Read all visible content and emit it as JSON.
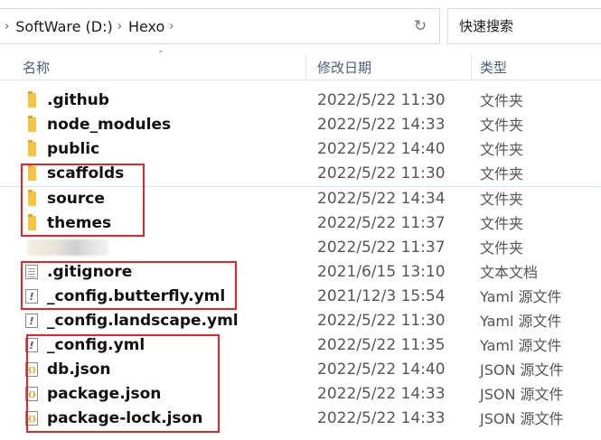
{
  "address": {
    "crumbs": [
      "SoftWare (D:)",
      "Hexo"
    ]
  },
  "search": {
    "placeholder": "快速搜索"
  },
  "columns": {
    "name": "名称",
    "date": "修改日期",
    "type": "类型"
  },
  "files": [
    {
      "name": ".github",
      "date": "2022/5/22 11:30",
      "type": "文件夹",
      "icon": "folder-icon"
    },
    {
      "name": "node_modules",
      "date": "2022/5/22 14:33",
      "type": "文件夹",
      "icon": "folder-icon"
    },
    {
      "name": "public",
      "date": "2022/5/22 14:40",
      "type": "文件夹",
      "icon": "folder-icon"
    },
    {
      "name": "scaffolds",
      "date": "2022/5/22 11:30",
      "type": "文件夹",
      "icon": "folder-icon"
    },
    {
      "name": "source",
      "date": "2022/5/22 14:34",
      "type": "文件夹",
      "icon": "folder-icon"
    },
    {
      "name": "themes",
      "date": "2022/5/22 11:37",
      "type": "文件夹",
      "icon": "folder-icon"
    },
    {
      "name": "",
      "date": "2022/5/22 11:37",
      "type": "文件夹",
      "icon": "blurred-icon"
    },
    {
      "name": ".gitignore",
      "date": "2021/6/15 13:10",
      "type": "文本文档",
      "icon": "text-file-icon"
    },
    {
      "name": "_config.butterfly.yml",
      "date": "2021/12/3 15:54",
      "type": "Yaml 源文件",
      "icon": "yaml-file-icon"
    },
    {
      "name": "_config.landscape.yml",
      "date": "2022/5/22 11:30",
      "type": "Yaml 源文件",
      "icon": "yaml-file-icon"
    },
    {
      "name": "_config.yml",
      "date": "2022/5/22 11:35",
      "type": "Yaml 源文件",
      "icon": "yaml-file-icon"
    },
    {
      "name": "db.json",
      "date": "2022/5/22 14:40",
      "type": "JSON 源文件",
      "icon": "json-file-icon"
    },
    {
      "name": "package.json",
      "date": "2022/5/22 14:33",
      "type": "JSON 源文件",
      "icon": "json-file-icon"
    },
    {
      "name": "package-lock.json",
      "date": "2022/5/22 14:33",
      "type": "JSON 源文件",
      "icon": "json-file-icon"
    }
  ],
  "colors": {
    "highlight": "#e0262c",
    "folder": "#f6c443",
    "header_text": "#4a5d7a"
  }
}
